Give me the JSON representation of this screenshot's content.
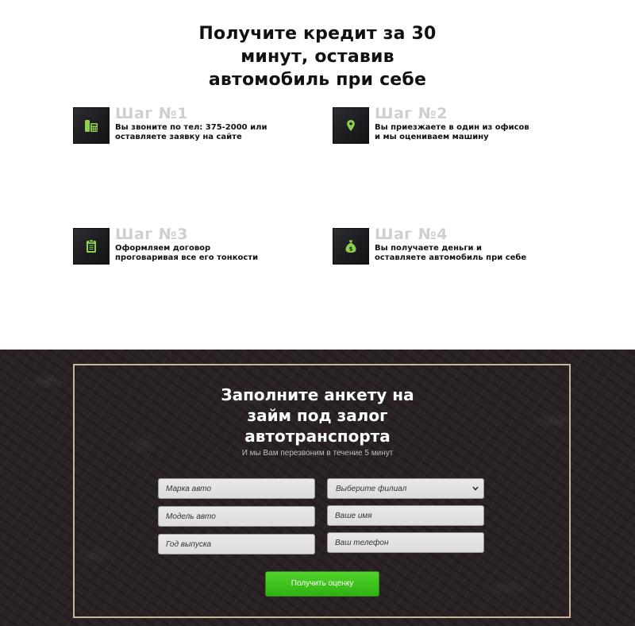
{
  "hero": {
    "title_lines": [
      "Получите кредит за 30",
      "минут, оставив",
      "автомобиль при себе"
    ]
  },
  "steps": [
    {
      "number": "Шаг №1",
      "icon": "phone-icon",
      "lines": [
        "Вы звоните по тел: 375-2000 или",
        "оставляете заявку на сайте"
      ]
    },
    {
      "number": "Шаг №2",
      "icon": "location-pin-icon",
      "lines": [
        "Вы приезжаете в один из офисов",
        "и мы оцениваем машину"
      ]
    },
    {
      "number": "Шаг №3",
      "icon": "clipboard-icon",
      "lines": [
        "Оформляем договор",
        "проговаривая все его тонкости"
      ]
    },
    {
      "number": "Шаг №4",
      "icon": "money-bag-icon",
      "lines": [
        "Вы получаете деньги и",
        "оставляете автомобиль при себе"
      ]
    }
  ],
  "form": {
    "title_lines": [
      "Заполните анкету на",
      "займ под залог",
      "автотранспорта"
    ],
    "subtitle": "И мы Вам перезвоним в течение 5 минут",
    "car_brand_placeholder": "Марка авто",
    "car_model_placeholder": "Модель авто",
    "year_placeholder": "Год выпуска",
    "branch_select": "Выберите филиал",
    "name_placeholder": "Ваше имя",
    "phone_placeholder": "Ваш телефон",
    "submit_label": "Получить оценку"
  },
  "colors": {
    "accent_green": "#8fd14f",
    "button_green": "#3cc11a",
    "frame_border": "#c8b49a",
    "dark_bg": "#2a2225"
  }
}
